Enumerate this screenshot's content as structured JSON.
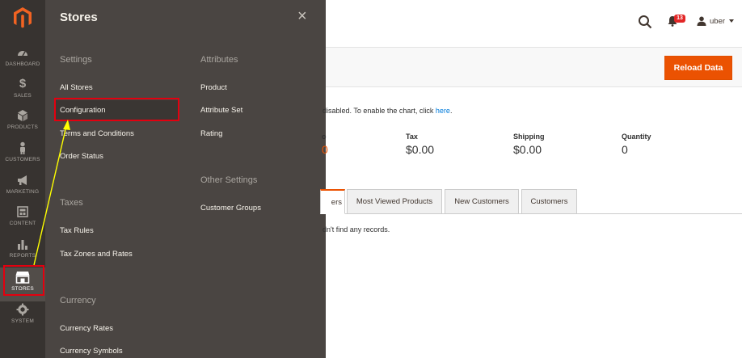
{
  "nav": {
    "items": [
      {
        "label": "DASHBOARD",
        "icon": "dashboard-gauge-icon"
      },
      {
        "label": "SALES",
        "icon": "dollar-icon"
      },
      {
        "label": "PRODUCTS",
        "icon": "cube-icon"
      },
      {
        "label": "CUSTOMERS",
        "icon": "person-icon"
      },
      {
        "label": "MARKETING",
        "icon": "megaphone-icon"
      },
      {
        "label": "CONTENT",
        "icon": "content-layout-icon"
      },
      {
        "label": "REPORTS",
        "icon": "bar-chart-icon"
      },
      {
        "label": "STORES",
        "icon": "storefront-icon",
        "active": true
      },
      {
        "label": "SYSTEM",
        "icon": "gear-icon"
      }
    ]
  },
  "flyout": {
    "title": "Stores",
    "close_glyph": "×",
    "settings": {
      "title": "Settings",
      "items": [
        "All Stores",
        "Configuration",
        "Terms and Conditions",
        "Order Status"
      ]
    },
    "taxes": {
      "title": "Taxes",
      "items": [
        "Tax Rules",
        "Tax Zones and Rates"
      ]
    },
    "currency": {
      "title": "Currency",
      "items": [
        "Currency Rates",
        "Currency Symbols"
      ]
    },
    "attributes": {
      "title": "Attributes",
      "items": [
        "Product",
        "Attribute Set",
        "Rating"
      ]
    },
    "other": {
      "title": "Other Settings",
      "items": [
        "Customer Groups"
      ]
    }
  },
  "header": {
    "notifications_count": "13",
    "user_name": "uber"
  },
  "toolbar": {
    "reload_label": "Reload Data"
  },
  "dashboard": {
    "chart_msg_prefix": "disabled. To enable the chart, click ",
    "chart_msg_link": "here",
    "chart_msg_suffix": ".",
    "totals": [
      {
        "label": "o",
        "value": "0"
      },
      {
        "label": "Tax",
        "value": "$0.00"
      },
      {
        "label": "Shipping",
        "value": "$0.00"
      },
      {
        "label": "Quantity",
        "value": "0"
      }
    ],
    "tabs": [
      "ers",
      "Most Viewed Products",
      "New Customers",
      "Customers"
    ],
    "no_records": "dn't find any records."
  },
  "colors": {
    "accent": "#eb5202",
    "nav_bg": "#373330",
    "flyout_bg": "#4a4542",
    "highlight": "#e3000f",
    "arrow": "#ffff00"
  }
}
